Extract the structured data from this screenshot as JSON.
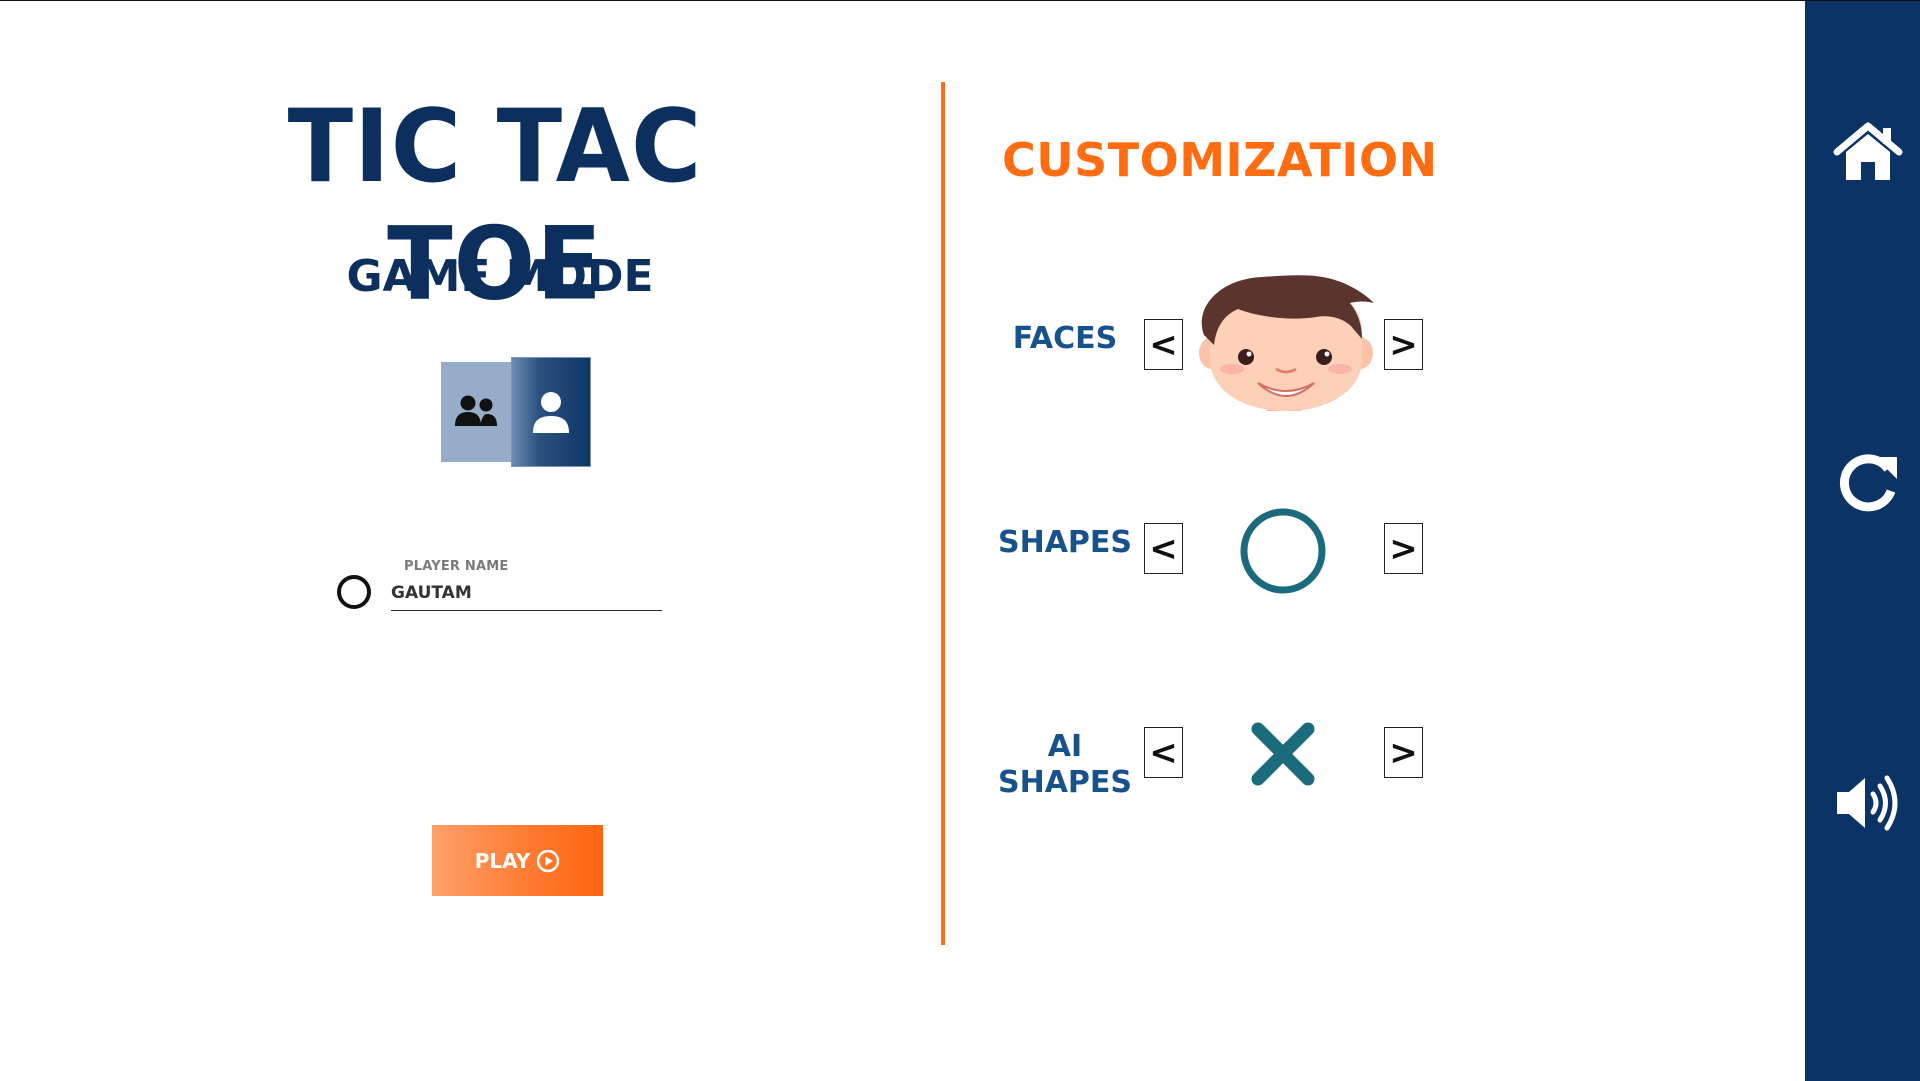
{
  "game": {
    "title": "TIC TAC TOE",
    "mode_heading": "GAME MODE",
    "modes": [
      {
        "icon": "two-players-icon",
        "selected": false
      },
      {
        "icon": "single-player-icon",
        "selected": true
      }
    ],
    "player": {
      "label": "PLAYER NAME",
      "value": "GAUTAM",
      "symbol_icon": "circle-icon"
    },
    "play_label": "PLAY"
  },
  "customization": {
    "heading": "CUSTOMIZATION",
    "rows": [
      {
        "label": "FACES",
        "prev": "<",
        "next": ">",
        "preview_icon": "boy-face-icon"
      },
      {
        "label": "SHAPES",
        "prev": "<",
        "next": ">",
        "preview_icon": "circle-shape-icon"
      },
      {
        "label_line1": "AI",
        "label_line2": "SHAPES",
        "prev": "<",
        "next": ">",
        "preview_icon": "x-shape-icon"
      }
    ]
  },
  "sidebar": {
    "items": [
      {
        "icon": "home-icon"
      },
      {
        "icon": "restart-icon"
      },
      {
        "icon": "volume-icon"
      }
    ]
  },
  "colors": {
    "navy": "#0c3366",
    "orange": "#ff6c12",
    "teal": "#1c6b7c",
    "label_blue": "#17528b"
  }
}
